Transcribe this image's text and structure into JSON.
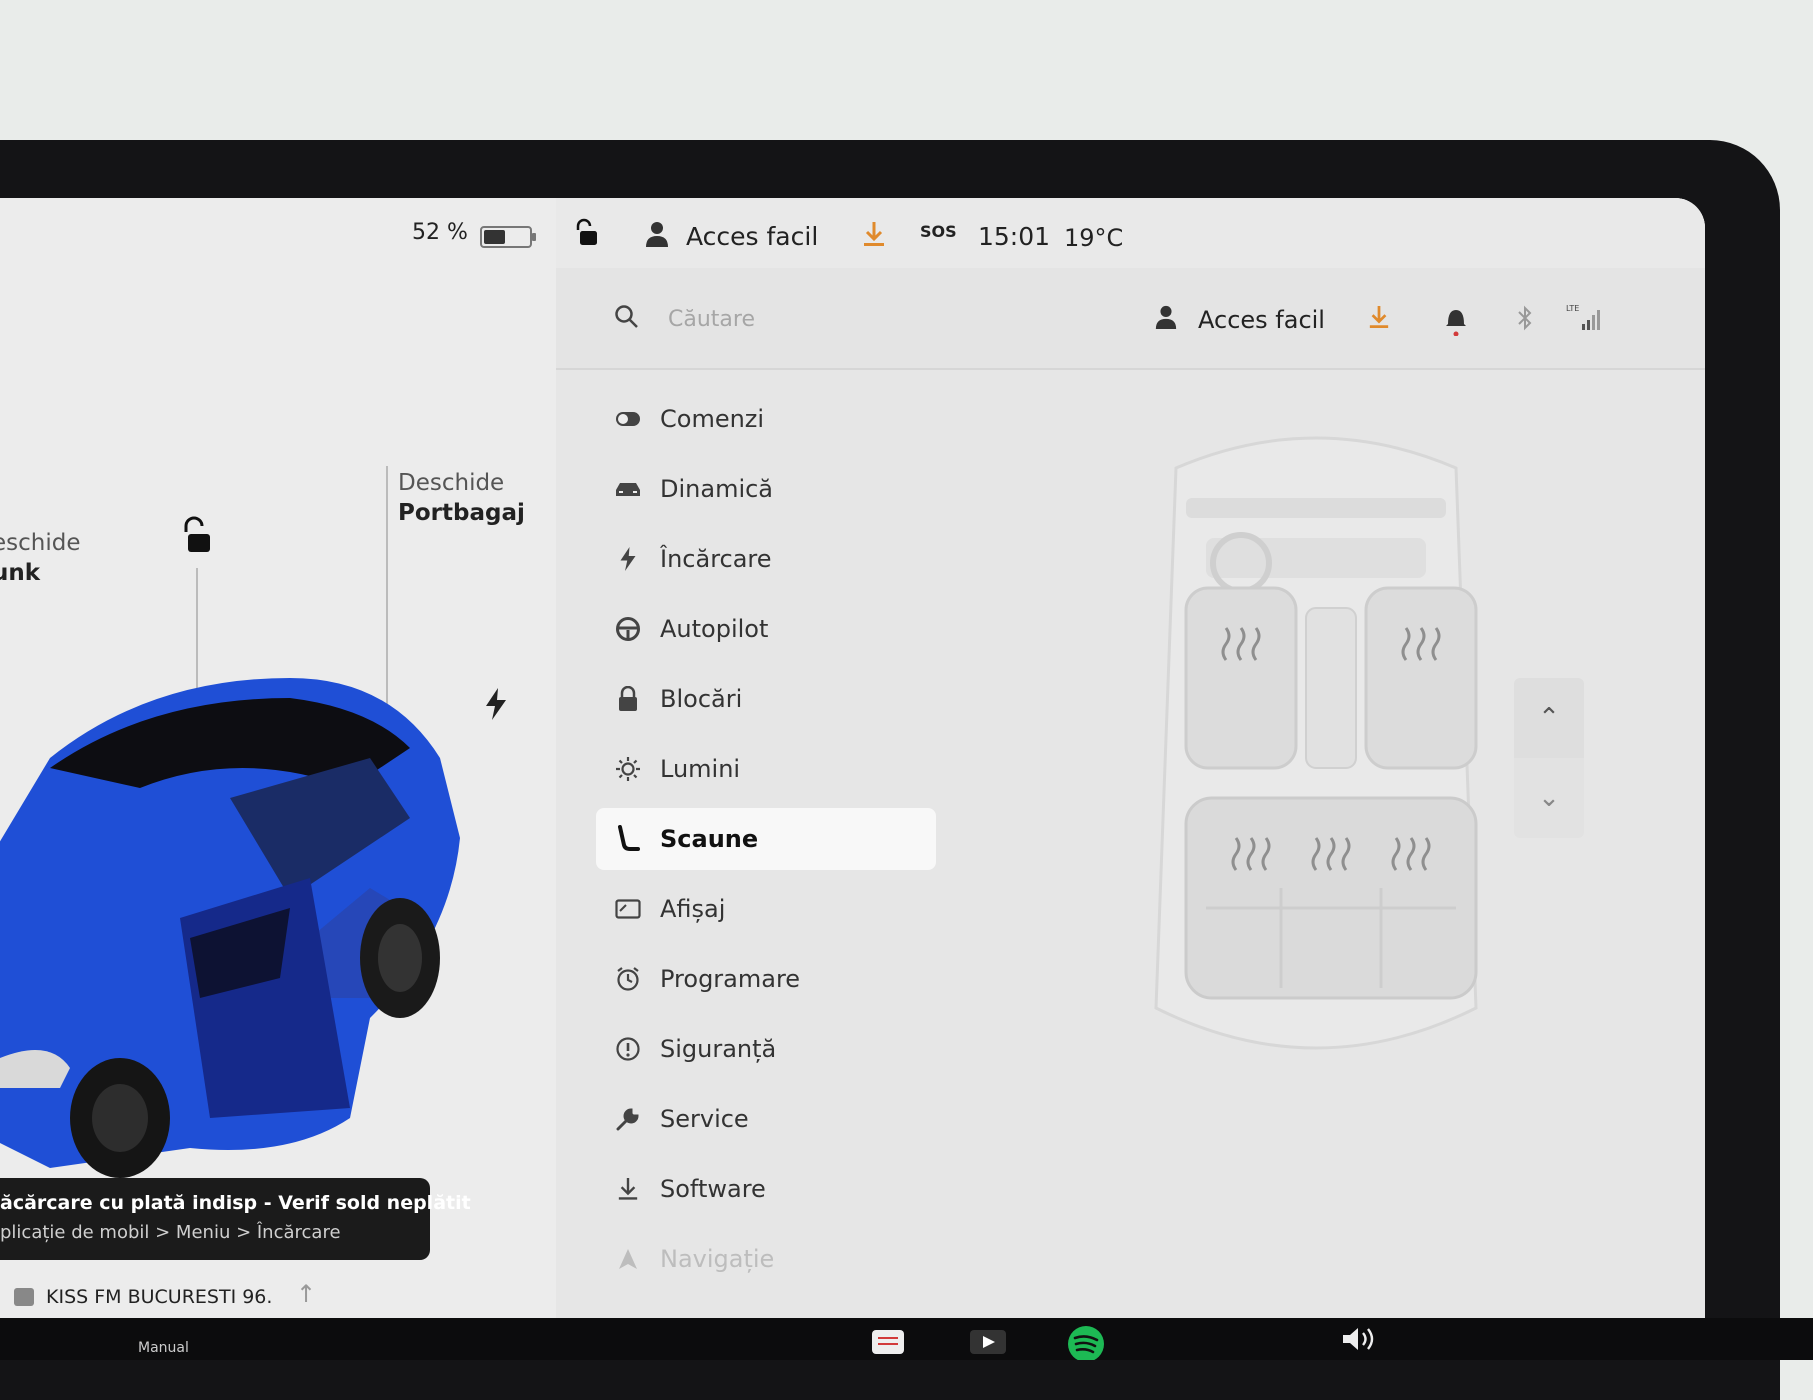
{
  "status": {
    "battery_percent": "52 %",
    "battery_level": 0.52,
    "clock": "15:01",
    "temperature": "19°C",
    "sos": "SOS"
  },
  "car": {
    "trunk_action": "eschide",
    "trunk_name": "unk",
    "frunk_action": "Deschide",
    "frunk_name": "Portbagaj"
  },
  "notification": {
    "title": "ăcărcare cu plată indisp - Verif sold neplătit",
    "subtitle": "plicație de mobil > Meniu > Încărcare"
  },
  "media": {
    "station": "KISS FM BUCURESTI 96.",
    "manual_label": "Manual"
  },
  "topbar": {
    "profile_name": "Acces facil"
  },
  "search": {
    "placeholder": "Căutare",
    "profile_name": "Acces facil",
    "lte_label": "LTE"
  },
  "menu": {
    "items": [
      {
        "label": "Comenzi",
        "icon": "toggle-icon"
      },
      {
        "label": "Dinamică",
        "icon": "car-icon"
      },
      {
        "label": "Încărcare",
        "icon": "bolt-icon"
      },
      {
        "label": "Autopilot",
        "icon": "steering-wheel-icon"
      },
      {
        "label": "Blocări",
        "icon": "lock-icon"
      },
      {
        "label": "Lumini",
        "icon": "sun-icon"
      },
      {
        "label": "Scaune",
        "icon": "seat-icon"
      },
      {
        "label": "Afișaj",
        "icon": "display-icon"
      },
      {
        "label": "Programare",
        "icon": "alarm-clock-icon"
      },
      {
        "label": "Siguranță",
        "icon": "alert-circle-icon"
      },
      {
        "label": "Service",
        "icon": "wrench-icon"
      },
      {
        "label": "Software",
        "icon": "download-icon"
      },
      {
        "label": "Navigație",
        "icon": "navigation-icon"
      }
    ],
    "active": "Scaune"
  },
  "colors": {
    "accent_orange": "#e08a2c",
    "notification_dot": "#d23a3a",
    "car_blue": "#1f4fd6"
  }
}
